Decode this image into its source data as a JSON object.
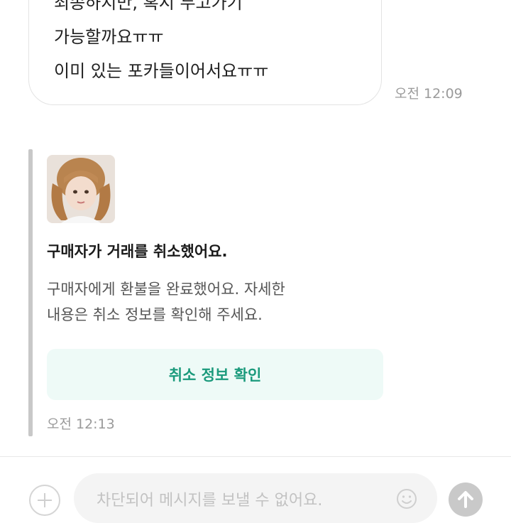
{
  "previous_message": {
    "lines": [
      "죄송하지만, 혹시 두고가기",
      "가능할까요ㅠㅠ",
      "이미 있는 포카들이어서요ㅠㅠ"
    ],
    "time": "오전 12:09"
  },
  "system_card": {
    "title": "구매자가 거래를 취소했어요.",
    "description_lines": [
      "구매자에게 환불을 완료했어요. 자세한",
      "내용은 취소 정보를 확인해 주세요."
    ],
    "button_label": "취소 정보 확인",
    "time": "오전 12:13",
    "accent_color": "#1b9a7c"
  },
  "composer": {
    "placeholder": "차단되어 메시지를 보낼 수 없어요.",
    "icons": [
      "plus-icon",
      "emoji-icon",
      "send-arrow-icon"
    ]
  }
}
